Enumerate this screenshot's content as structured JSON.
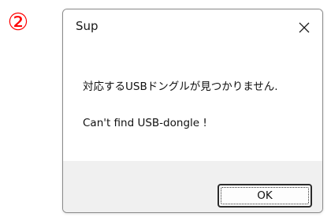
{
  "annotation": {
    "step_marker": "②"
  },
  "dialog": {
    "title": "Sup",
    "message_jp": "対応するUSBドングルが見つかりません.",
    "message_en": "Can't find USB-dongle !",
    "ok_label": "OK",
    "close_icon": "close-icon"
  },
  "colors": {
    "step_marker": "#ff0000",
    "footer_background": "#f0f0f0",
    "dialog_border": "#8a8a8a"
  }
}
